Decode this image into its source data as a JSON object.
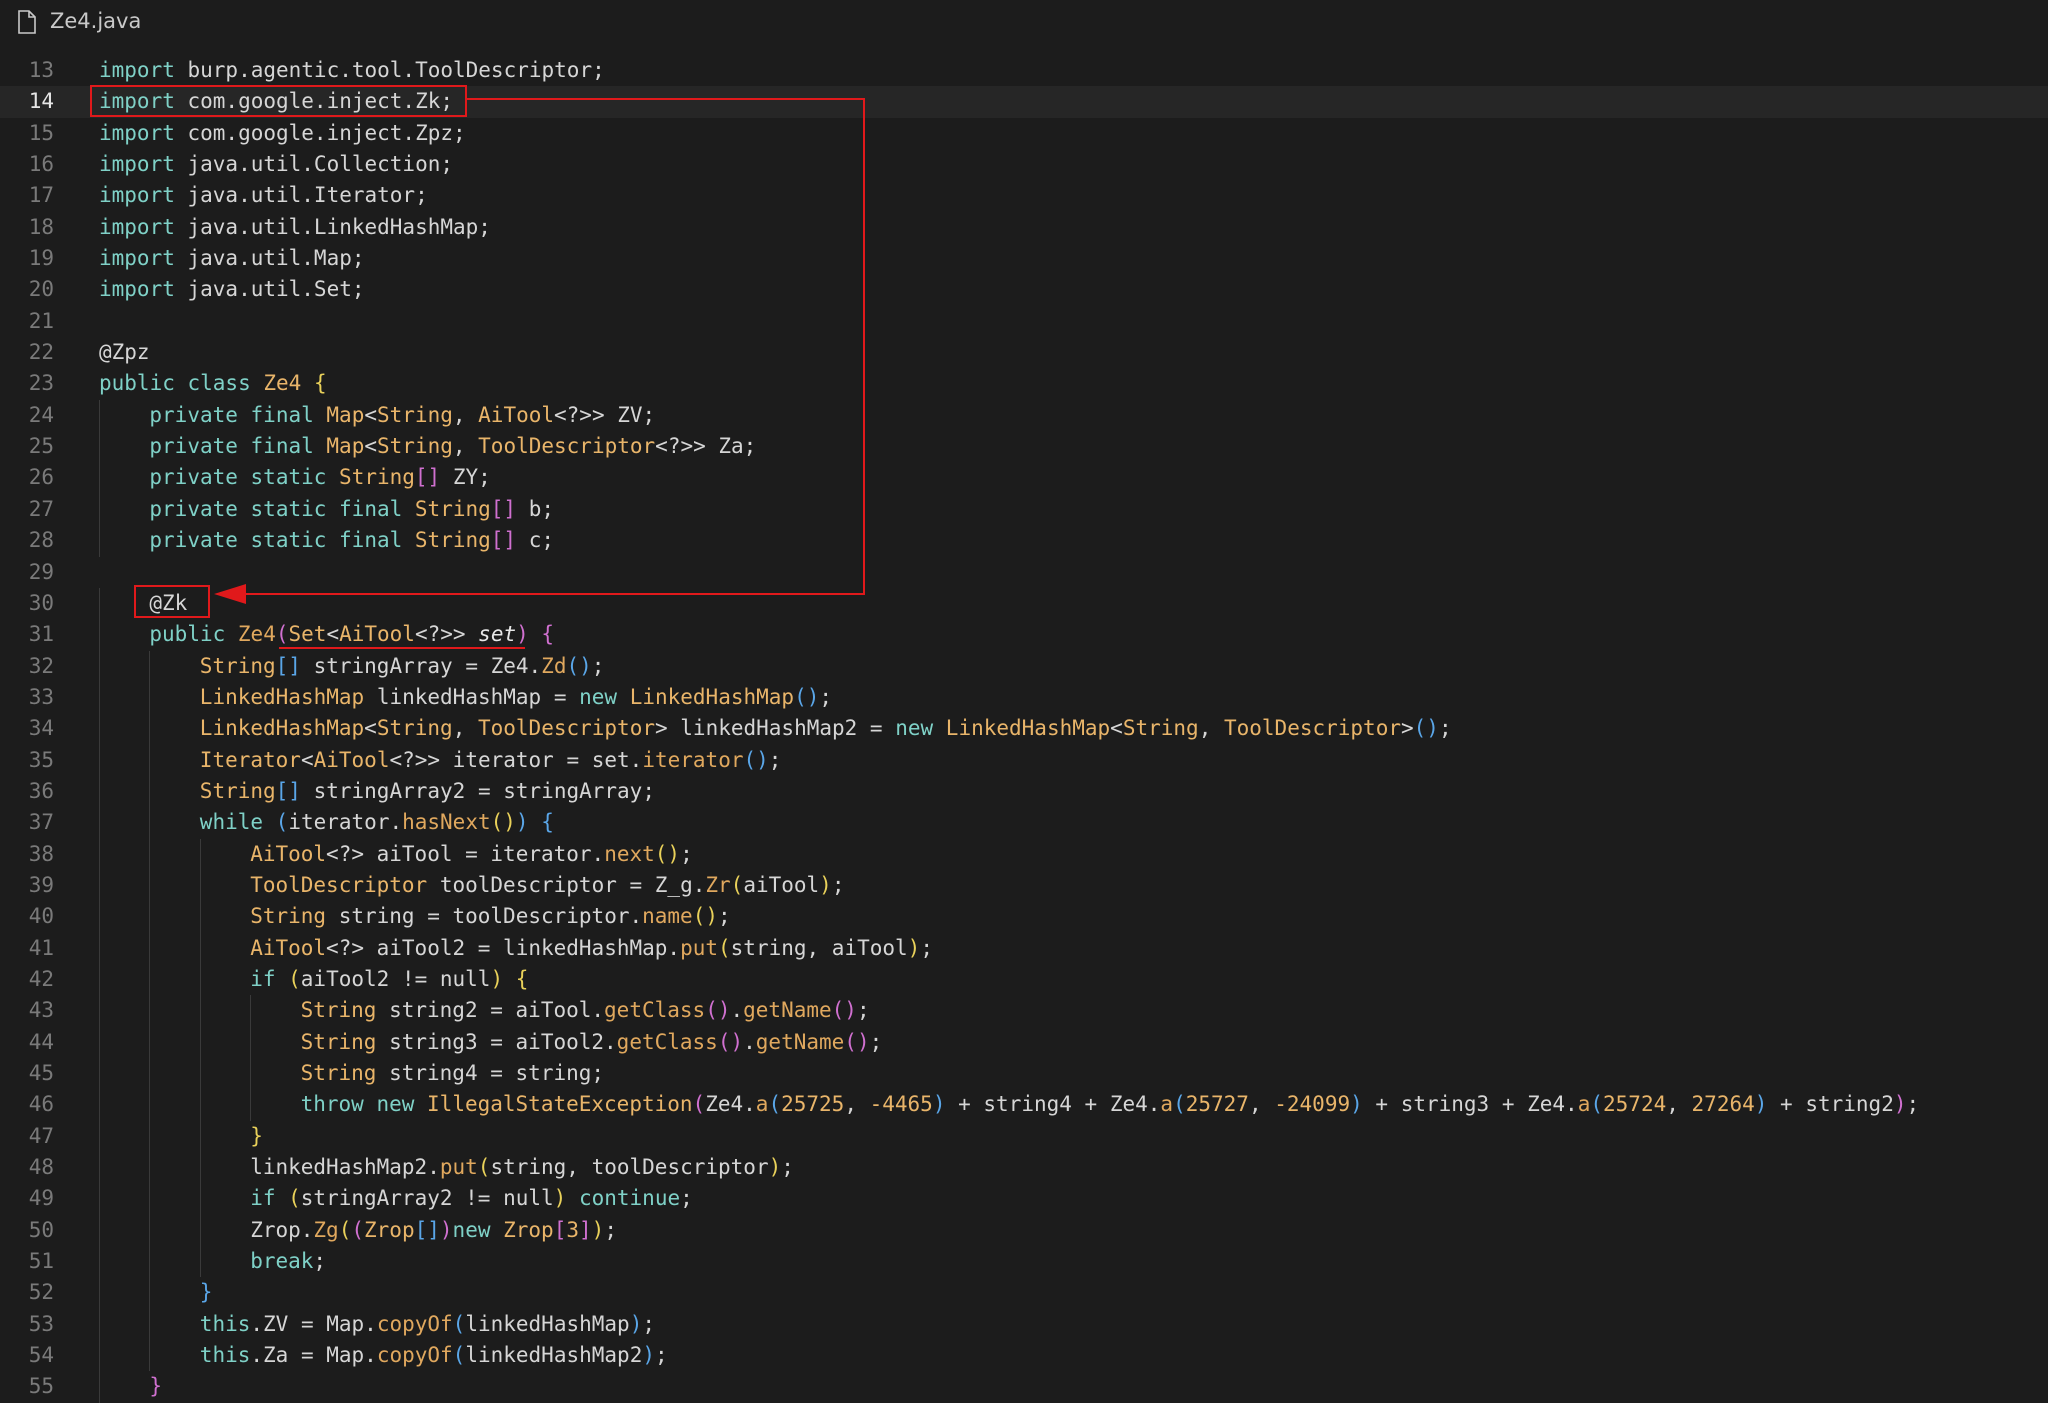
{
  "tab": {
    "file_name": "Ze4.java",
    "icon": "file-icon"
  },
  "editor": {
    "current_line": 14,
    "lines": [
      {
        "n": "13",
        "indent": 0,
        "tokens": [
          [
            "kw",
            "import"
          ],
          [
            "pl",
            " burp.agentic.tool.ToolDescriptor;"
          ]
        ]
      },
      {
        "n": "14",
        "indent": 0,
        "tokens": [
          [
            "kw",
            "import"
          ],
          [
            "pl",
            " com.google.inject.Zk;"
          ]
        ]
      },
      {
        "n": "15",
        "indent": 0,
        "tokens": [
          [
            "kw",
            "import"
          ],
          [
            "pl",
            " com.google.inject.Zpz;"
          ]
        ]
      },
      {
        "n": "16",
        "indent": 0,
        "tokens": [
          [
            "kw",
            "import"
          ],
          [
            "pl",
            " java.util.Collection;"
          ]
        ]
      },
      {
        "n": "17",
        "indent": 0,
        "tokens": [
          [
            "kw",
            "import"
          ],
          [
            "pl",
            " java.util.Iterator;"
          ]
        ]
      },
      {
        "n": "18",
        "indent": 0,
        "tokens": [
          [
            "kw",
            "import"
          ],
          [
            "pl",
            " java.util.LinkedHashMap;"
          ]
        ]
      },
      {
        "n": "19",
        "indent": 0,
        "tokens": [
          [
            "kw",
            "import"
          ],
          [
            "pl",
            " java.util.Map;"
          ]
        ]
      },
      {
        "n": "20",
        "indent": 0,
        "tokens": [
          [
            "kw",
            "import"
          ],
          [
            "pl",
            " java.util.Set;"
          ]
        ]
      },
      {
        "n": "21",
        "indent": 0,
        "tokens": []
      },
      {
        "n": "22",
        "indent": 0,
        "tokens": [
          [
            "an",
            "@Zpz"
          ]
        ]
      },
      {
        "n": "23",
        "indent": 0,
        "tokens": [
          [
            "kw",
            "public class "
          ],
          [
            "ty",
            "Ze4"
          ],
          [
            "p2",
            " {"
          ]
        ]
      },
      {
        "n": "24",
        "indent": 1,
        "tokens": [
          [
            "kw",
            "private final "
          ],
          [
            "ty",
            "Map"
          ],
          [
            "pl",
            "<"
          ],
          [
            "ty",
            "String"
          ],
          [
            "pl",
            ", "
          ],
          [
            "ty",
            "AiTool"
          ],
          [
            "pl",
            "<?>> ZV;"
          ]
        ]
      },
      {
        "n": "25",
        "indent": 1,
        "tokens": [
          [
            "kw",
            "private final "
          ],
          [
            "ty",
            "Map"
          ],
          [
            "pl",
            "<"
          ],
          [
            "ty",
            "String"
          ],
          [
            "pl",
            ", "
          ],
          [
            "ty",
            "ToolDescriptor"
          ],
          [
            "pl",
            "<?>> Za;"
          ]
        ]
      },
      {
        "n": "26",
        "indent": 1,
        "tokens": [
          [
            "kw",
            "private static "
          ],
          [
            "ty",
            "String"
          ],
          [
            "p3",
            "[]"
          ],
          [
            "pl",
            " ZY;"
          ]
        ]
      },
      {
        "n": "27",
        "indent": 1,
        "tokens": [
          [
            "kw",
            "private static final "
          ],
          [
            "ty",
            "String"
          ],
          [
            "p3",
            "[]"
          ],
          [
            "pl",
            " b;"
          ]
        ]
      },
      {
        "n": "28",
        "indent": 1,
        "tokens": [
          [
            "kw",
            "private static final "
          ],
          [
            "ty",
            "String"
          ],
          [
            "p3",
            "[]"
          ],
          [
            "pl",
            " c;"
          ]
        ]
      },
      {
        "n": "29",
        "indent": 0,
        "tokens": []
      },
      {
        "n": "30",
        "indent": 1,
        "tokens": [
          [
            "an",
            "@Zk"
          ]
        ]
      },
      {
        "n": "31",
        "indent": 1,
        "tokens": [
          [
            "kw",
            "public "
          ],
          [
            "fn",
            "Ze4"
          ],
          [
            "p3",
            "("
          ],
          [
            "ty",
            "Set"
          ],
          [
            "pl",
            "<"
          ],
          [
            "ty",
            "AiTool"
          ],
          [
            "pl",
            "<?>> "
          ],
          [
            "it",
            "set"
          ],
          [
            "p3",
            ")"
          ],
          [
            "p3",
            " {"
          ]
        ]
      },
      {
        "n": "32",
        "indent": 2,
        "tokens": [
          [
            "ty",
            "String"
          ],
          [
            "p1",
            "[]"
          ],
          [
            "pl",
            " stringArray = Ze4."
          ],
          [
            "fn",
            "Zd"
          ],
          [
            "p1",
            "()"
          ],
          [
            "pl",
            ";"
          ]
        ]
      },
      {
        "n": "33",
        "indent": 2,
        "tokens": [
          [
            "ty",
            "LinkedHashMap"
          ],
          [
            "pl",
            " linkedHashMap = "
          ],
          [
            "kw",
            "new "
          ],
          [
            "ty",
            "LinkedHashMap"
          ],
          [
            "p1",
            "()"
          ],
          [
            "pl",
            ";"
          ]
        ]
      },
      {
        "n": "34",
        "indent": 2,
        "tokens": [
          [
            "ty",
            "LinkedHashMap"
          ],
          [
            "pl",
            "<"
          ],
          [
            "ty",
            "String"
          ],
          [
            "pl",
            ", "
          ],
          [
            "ty",
            "ToolDescriptor"
          ],
          [
            "pl",
            "> linkedHashMap2 = "
          ],
          [
            "kw",
            "new "
          ],
          [
            "ty",
            "LinkedHashMap"
          ],
          [
            "pl",
            "<"
          ],
          [
            "ty",
            "String"
          ],
          [
            "pl",
            ", "
          ],
          [
            "ty",
            "ToolDescriptor"
          ],
          [
            "pl",
            ">"
          ],
          [
            "p1",
            "()"
          ],
          [
            "pl",
            ";"
          ]
        ]
      },
      {
        "n": "35",
        "indent": 2,
        "tokens": [
          [
            "ty",
            "Iterator"
          ],
          [
            "pl",
            "<"
          ],
          [
            "ty",
            "AiTool"
          ],
          [
            "pl",
            "<?>> iterator = set."
          ],
          [
            "fn",
            "iterator"
          ],
          [
            "p1",
            "()"
          ],
          [
            "pl",
            ";"
          ]
        ]
      },
      {
        "n": "36",
        "indent": 2,
        "tokens": [
          [
            "ty",
            "String"
          ],
          [
            "p1",
            "[]"
          ],
          [
            "pl",
            " stringArray2 = stringArray;"
          ]
        ]
      },
      {
        "n": "37",
        "indent": 2,
        "tokens": [
          [
            "kw",
            "while "
          ],
          [
            "p1",
            "("
          ],
          [
            "pl",
            "iterator."
          ],
          [
            "fn",
            "hasNext"
          ],
          [
            "p2",
            "()"
          ],
          [
            "p1",
            ")"
          ],
          [
            "p1",
            " {"
          ]
        ]
      },
      {
        "n": "38",
        "indent": 3,
        "tokens": [
          [
            "ty",
            "AiTool"
          ],
          [
            "pl",
            "<?> aiTool = iterator."
          ],
          [
            "fn",
            "next"
          ],
          [
            "p2",
            "()"
          ],
          [
            "pl",
            ";"
          ]
        ]
      },
      {
        "n": "39",
        "indent": 3,
        "tokens": [
          [
            "ty",
            "ToolDescriptor"
          ],
          [
            "pl",
            " toolDescriptor = Z_g."
          ],
          [
            "fn",
            "Zr"
          ],
          [
            "p2",
            "("
          ],
          [
            "pl",
            "aiTool"
          ],
          [
            "p2",
            ")"
          ],
          [
            "pl",
            ";"
          ]
        ]
      },
      {
        "n": "40",
        "indent": 3,
        "tokens": [
          [
            "ty",
            "String"
          ],
          [
            "pl",
            " string = toolDescriptor."
          ],
          [
            "fn",
            "name"
          ],
          [
            "p2",
            "()"
          ],
          [
            "pl",
            ";"
          ]
        ]
      },
      {
        "n": "41",
        "indent": 3,
        "tokens": [
          [
            "ty",
            "AiTool"
          ],
          [
            "pl",
            "<?> aiTool2 = linkedHashMap."
          ],
          [
            "fn",
            "put"
          ],
          [
            "p2",
            "("
          ],
          [
            "pl",
            "string, aiTool"
          ],
          [
            "p2",
            ")"
          ],
          [
            "pl",
            ";"
          ]
        ]
      },
      {
        "n": "42",
        "indent": 3,
        "tokens": [
          [
            "kw",
            "if "
          ],
          [
            "p2",
            "("
          ],
          [
            "pl",
            "aiTool2 != null"
          ],
          [
            "p2",
            ")"
          ],
          [
            "p2",
            " {"
          ]
        ]
      },
      {
        "n": "43",
        "indent": 4,
        "tokens": [
          [
            "ty",
            "String"
          ],
          [
            "pl",
            " string2 = aiTool."
          ],
          [
            "fn",
            "getClass"
          ],
          [
            "p3",
            "()"
          ],
          [
            "pl",
            "."
          ],
          [
            "fn",
            "getName"
          ],
          [
            "p3",
            "()"
          ],
          [
            "pl",
            ";"
          ]
        ]
      },
      {
        "n": "44",
        "indent": 4,
        "tokens": [
          [
            "ty",
            "String"
          ],
          [
            "pl",
            " string3 = aiTool2."
          ],
          [
            "fn",
            "getClass"
          ],
          [
            "p3",
            "()"
          ],
          [
            "pl",
            "."
          ],
          [
            "fn",
            "getName"
          ],
          [
            "p3",
            "()"
          ],
          [
            "pl",
            ";"
          ]
        ]
      },
      {
        "n": "45",
        "indent": 4,
        "tokens": [
          [
            "ty",
            "String"
          ],
          [
            "pl",
            " string4 = string;"
          ]
        ]
      },
      {
        "n": "46",
        "indent": 4,
        "tokens": [
          [
            "kw",
            "throw new "
          ],
          [
            "ty",
            "IllegalStateException"
          ],
          [
            "p3",
            "("
          ],
          [
            "pl",
            "Ze4."
          ],
          [
            "fn",
            "a"
          ],
          [
            "p1",
            "("
          ],
          [
            "nu",
            "25725"
          ],
          [
            "pl",
            ", "
          ],
          [
            "nu",
            "-4465"
          ],
          [
            "p1",
            ")"
          ],
          [
            "pl",
            " + string4 + Ze4."
          ],
          [
            "fn",
            "a"
          ],
          [
            "p1",
            "("
          ],
          [
            "nu",
            "25727"
          ],
          [
            "pl",
            ", "
          ],
          [
            "nu",
            "-24099"
          ],
          [
            "p1",
            ")"
          ],
          [
            "pl",
            " + string3 + Ze4."
          ],
          [
            "fn",
            "a"
          ],
          [
            "p1",
            "("
          ],
          [
            "nu",
            "25724"
          ],
          [
            "pl",
            ", "
          ],
          [
            "nu",
            "27264"
          ],
          [
            "p1",
            ")"
          ],
          [
            "pl",
            " + string2"
          ],
          [
            "p3",
            ")"
          ],
          [
            "pl",
            ";"
          ]
        ]
      },
      {
        "n": "47",
        "indent": 3,
        "tokens": [
          [
            "p2",
            "}"
          ]
        ]
      },
      {
        "n": "48",
        "indent": 3,
        "tokens": [
          [
            "pl",
            "linkedHashMap2."
          ],
          [
            "fn",
            "put"
          ],
          [
            "p2",
            "("
          ],
          [
            "pl",
            "string, toolDescriptor"
          ],
          [
            "p2",
            ")"
          ],
          [
            "pl",
            ";"
          ]
        ]
      },
      {
        "n": "49",
        "indent": 3,
        "tokens": [
          [
            "kw",
            "if "
          ],
          [
            "p2",
            "("
          ],
          [
            "pl",
            "stringArray2 != null"
          ],
          [
            "p2",
            ")"
          ],
          [
            "kw",
            " continue"
          ],
          [
            "pl",
            ";"
          ]
        ]
      },
      {
        "n": "50",
        "indent": 3,
        "tokens": [
          [
            "pl",
            "Zrop."
          ],
          [
            "fn",
            "Zg"
          ],
          [
            "p2",
            "("
          ],
          [
            "p3",
            "("
          ],
          [
            "ty",
            "Zrop"
          ],
          [
            "p1",
            "[]"
          ],
          [
            "p3",
            ")"
          ],
          [
            "kw",
            "new "
          ],
          [
            "ty",
            "Zrop"
          ],
          [
            "p3",
            "["
          ],
          [
            "nu",
            "3"
          ],
          [
            "p3",
            "]"
          ],
          [
            "p2",
            ")"
          ],
          [
            "pl",
            ";"
          ]
        ]
      },
      {
        "n": "51",
        "indent": 3,
        "tokens": [
          [
            "kw",
            "break"
          ],
          [
            "pl",
            ";"
          ]
        ]
      },
      {
        "n": "52",
        "indent": 2,
        "tokens": [
          [
            "p1",
            "}"
          ]
        ]
      },
      {
        "n": "53",
        "indent": 2,
        "tokens": [
          [
            "kw",
            "this"
          ],
          [
            "pl",
            ".ZV = Map."
          ],
          [
            "fn",
            "copyOf"
          ],
          [
            "p1",
            "("
          ],
          [
            "pl",
            "linkedHashMap"
          ],
          [
            "p1",
            ")"
          ],
          [
            "pl",
            ";"
          ]
        ]
      },
      {
        "n": "54",
        "indent": 2,
        "tokens": [
          [
            "kw",
            "this"
          ],
          [
            "pl",
            ".Za = Map."
          ],
          [
            "fn",
            "copyOf"
          ],
          [
            "p1",
            "("
          ],
          [
            "pl",
            "linkedHashMap2"
          ],
          [
            "p1",
            ")"
          ],
          [
            "pl",
            ";"
          ]
        ]
      },
      {
        "n": "55",
        "indent": 1,
        "tokens": [
          [
            "p3",
            "}"
          ]
        ]
      }
    ]
  },
  "annotations": {
    "color": "#e0191b",
    "highlight_import": "import com.google.inject.Zk;",
    "highlight_annotation": "@Zk",
    "underline_text": "Set<AiTool<?>> set)"
  }
}
